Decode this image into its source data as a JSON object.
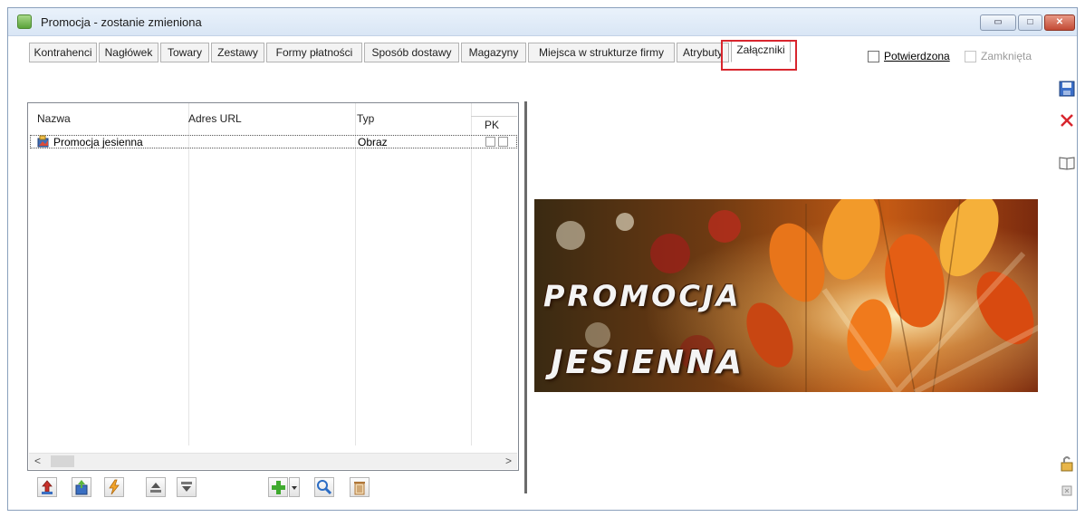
{
  "window": {
    "title": "Promocja - zostanie zmieniona",
    "minimize_glyph": "▭",
    "maximize_glyph": "□",
    "close_glyph": "✕"
  },
  "tabs": [
    {
      "label": "Kontrahenci"
    },
    {
      "label": "Nagłówek"
    },
    {
      "label": "Towary"
    },
    {
      "label": "Zestawy"
    },
    {
      "label": "Formy płatności"
    },
    {
      "label": "Sposób dostawy"
    },
    {
      "label": "Magazyny"
    },
    {
      "label": "Miejsca w strukturze firmy"
    },
    {
      "label": "Atrybuty"
    },
    {
      "label": "Załączniki",
      "active": true
    }
  ],
  "flags": {
    "potwierdzona": {
      "label": "Potwierdzona",
      "checked": false,
      "enabled": true
    },
    "zamknieta": {
      "label": "Zamknięta",
      "checked": false,
      "enabled": false
    }
  },
  "attachments": {
    "columns": [
      "Nazwa",
      "Adres URL",
      "Typ",
      "PK"
    ],
    "rows": [
      {
        "name": "Promocja jesienna",
        "url": "",
        "type": "Obraz",
        "icon": "attachment-image-icon"
      }
    ]
  },
  "scrollbar": {
    "left_arrow": "<",
    "right_arrow": ">"
  },
  "preview": {
    "line1": "PROMOCJA",
    "line2": "JESIENNA"
  },
  "colors": {
    "highlight": "#d8262e",
    "tab_active_bg": "#ffffff",
    "banner_orange": "#e8751a"
  },
  "icons": {
    "toolbar": [
      "import-icon",
      "export-icon",
      "refresh-icon",
      "move-up-icon",
      "move-down-icon",
      "add-icon",
      "dropdown-icon",
      "preview-icon",
      "delete-icon"
    ],
    "side": [
      "save-icon",
      "cancel-icon",
      "book-icon",
      "lock-icon",
      "pin-icon"
    ]
  }
}
